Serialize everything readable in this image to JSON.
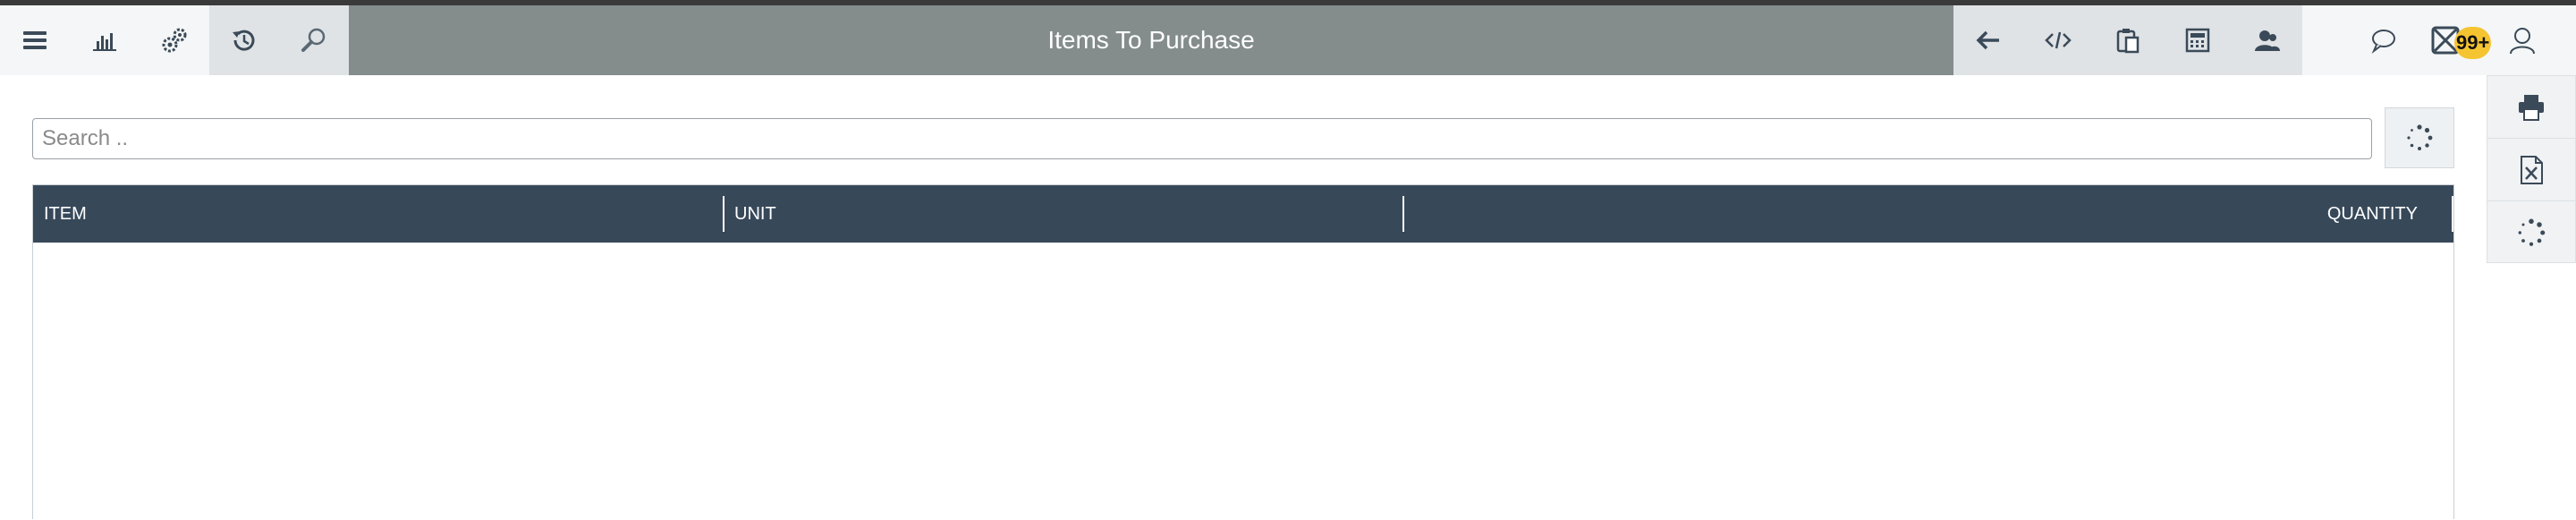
{
  "header": {
    "title": "Items To Purchase",
    "notification_badge": "99+"
  },
  "toolbar": {
    "left_icons": [
      "menu-icon",
      "chart-icon",
      "settings-gears-icon"
    ],
    "history_icons": [
      "history-icon",
      "search-zoom-icon"
    ],
    "action_icons": [
      "back-arrow-icon",
      "code-icon",
      "clipboard-icon",
      "calculator-icon",
      "users-icon"
    ],
    "right_icons": [
      "chat-icon",
      "mail-icon",
      "user-icon"
    ]
  },
  "search": {
    "placeholder": "Search .."
  },
  "side_panel": {
    "icons": [
      "print-icon",
      "excel-icon",
      "loading-icon"
    ]
  },
  "table": {
    "columns": [
      "ITEM",
      "UNIT",
      "QUANTITY"
    ],
    "rows": []
  },
  "colors": {
    "title_bar": "#848c8c",
    "table_header": "#374859",
    "badge": "#f5c431"
  }
}
